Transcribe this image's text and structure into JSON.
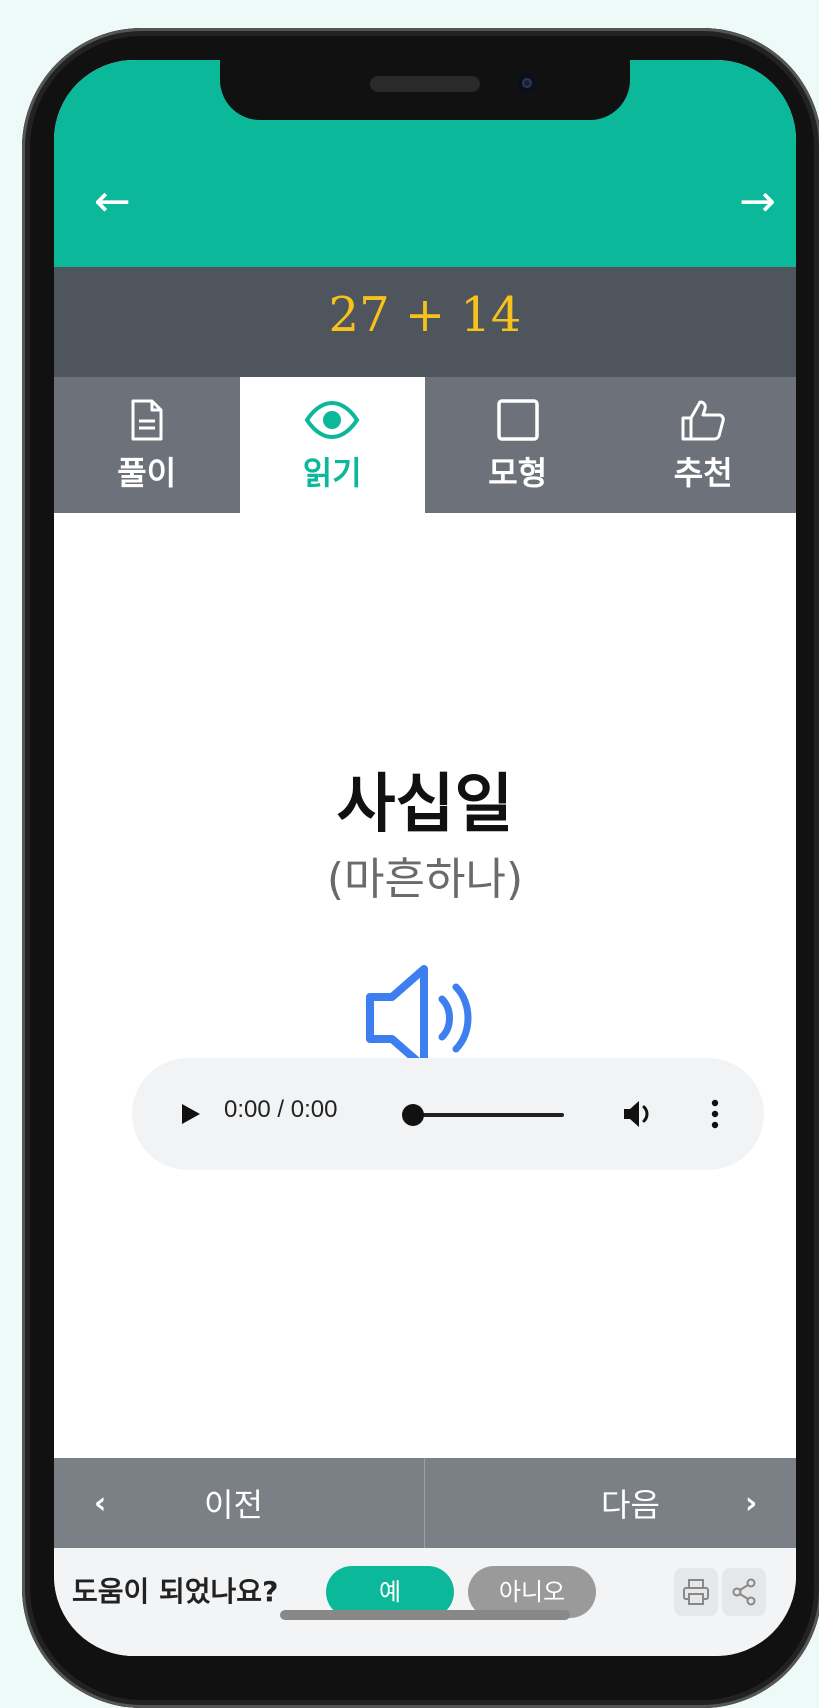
{
  "header": {
    "back_arrow": "←",
    "forward_arrow": "→"
  },
  "problem": {
    "expression": "27 + 14"
  },
  "tabs": [
    {
      "label": "풀이",
      "icon": "document-icon"
    },
    {
      "label": "읽기",
      "icon": "eye-icon",
      "active": true
    },
    {
      "label": "모형",
      "icon": "square-icon"
    },
    {
      "label": "추천",
      "icon": "thumbs-up-icon"
    }
  ],
  "reading": {
    "main": "사십일",
    "sub": "(마흔하나)"
  },
  "audio": {
    "time": "0:00 / 0:00"
  },
  "footer": {
    "prev_label": "이전",
    "next_label": "다음",
    "prev_chevron": "‹",
    "next_chevron": "›"
  },
  "feedback": {
    "question": "도움이 되었나요?",
    "yes": "예",
    "no": "아니오"
  },
  "colors": {
    "accent": "#0bb89a",
    "problem_bg": "#4f555c",
    "problem_text": "#f6c21b",
    "tab_bg": "#6d727a",
    "speaker_blue": "#3d7ef0"
  }
}
